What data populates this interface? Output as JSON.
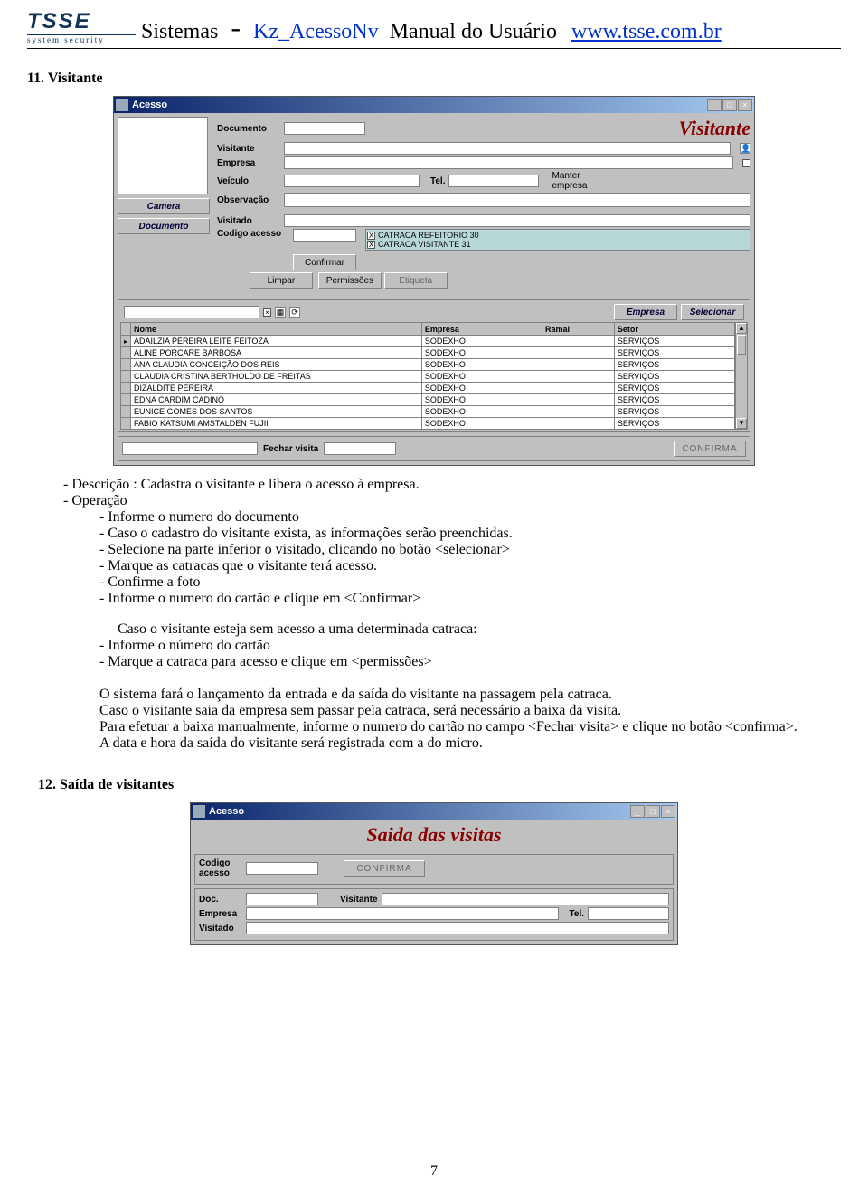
{
  "header": {
    "logo_text": "TSSE",
    "logo_sub": "system security",
    "t1": "Sistemas",
    "dash": "-",
    "t2": "Kz_AcessoNv",
    "t3": "Manual do Usuário",
    "link": "www.tsse.com.br"
  },
  "section1": {
    "title": "11. Visitante"
  },
  "win1": {
    "title": "Acesso",
    "min": "_",
    "max": "□",
    "close": "×",
    "labels": {
      "documento": "Documento",
      "visitante": "Visitante",
      "empresa": "Empresa",
      "veiculo": "Veículo",
      "observacao": "Observação",
      "tel": "Tel.",
      "manter_empresa": "Manter empresa",
      "visitado": "Visitado",
      "codigo_acesso": "Codigo acesso",
      "empresa2": "Empresa",
      "nome": "Nome",
      "ramal": "Ramal",
      "setor": "Setor",
      "fechar_visita": "Fechar visita"
    },
    "banner": "Visitante",
    "catracas": [
      "CATRACA REFEITORIO 30",
      "CATRACA VISITANTE 31"
    ],
    "buttons": {
      "confirmar": "Confirmar",
      "camera": "Camera",
      "documento_btn": "Documento",
      "limpar": "Limpar",
      "permissoes": "Permissões",
      "etiqueta": "Etiqueta",
      "selecionar": "Selecionar",
      "confirma_footer": "CONFIRMA"
    },
    "grid_rows": [
      {
        "nome": "ADAILZIA PEREIRA LEITE FEITOZA",
        "empresa": "SODEXHO",
        "ramal": "",
        "setor": "SERVIÇOS"
      },
      {
        "nome": "ALINE PORCARE BARBOSA",
        "empresa": "SODEXHO",
        "ramal": "",
        "setor": "SERVIÇOS"
      },
      {
        "nome": "ANA CLAUDIA CONCEIÇÃO DOS REIS",
        "empresa": "SODEXHO",
        "ramal": "",
        "setor": "SERVIÇOS"
      },
      {
        "nome": "CLAUDIA CRISTINA BERTHOLDO DE FREITAS",
        "empresa": "SODEXHO",
        "ramal": "",
        "setor": "SERVIÇOS"
      },
      {
        "nome": "DIZALDITE PEREIRA",
        "empresa": "SODEXHO",
        "ramal": "",
        "setor": "SERVIÇOS"
      },
      {
        "nome": "EDNA CARDIM CADINO",
        "empresa": "SODEXHO",
        "ramal": "",
        "setor": "SERVIÇOS"
      },
      {
        "nome": "EUNICE GOMES DOS SANTOS",
        "empresa": "SODEXHO",
        "ramal": "",
        "setor": "SERVIÇOS"
      },
      {
        "nome": "FABIO KATSUMI AMSTALDEN FUJII",
        "empresa": "SODEXHO",
        "ramal": "",
        "setor": "SERVIÇOS"
      }
    ]
  },
  "body": {
    "l1": "-    Descrição : Cadastra o visitante e libera o acesso à empresa.",
    "l2": "-    Operação",
    "l3": "-    Informe o numero do documento",
    "l4": "-    Caso o cadastro do visitante exista, as informações serão preenchidas.",
    "l5": "-    Selecione na parte inferior o visitado, clicando no botão <selecionar>",
    "l6": "-    Marque as catracas que o visitante terá acesso.",
    "l7": "-    Confirme a foto",
    "l8": "-    Informe o numero do cartão e clique em <Confirmar>",
    "p1": "Caso o visitante esteja sem acesso a uma determinada catraca:",
    "l9": "-    Informe o número do cartão",
    "l10": "-    Marque a catraca para acesso e clique em <permissões>",
    "p2": "O sistema fará o lançamento da entrada  e da saída do visitante na passagem pela catraca.",
    "p3": "Caso o visitante saia da empresa sem passar pela catraca, será necessário a baixa da visita.",
    "p4": "Para efetuar a baixa manualmente, informe o numero do cartão no campo <Fechar visita> e clique no botão <confirma>.",
    "p5": " A data e hora da saída do visitante será registrada com a do micro."
  },
  "section2": {
    "title": "12. Saída de visitantes"
  },
  "win2": {
    "title": "Acesso",
    "min": "_",
    "max": "□",
    "close": "×",
    "banner": "Saida das visitas",
    "labels": {
      "codigo_acesso": "Codigo acesso",
      "doc": "Doc.",
      "visitante": "Visitante",
      "empresa": "Empresa",
      "tel": "Tel.",
      "visitado": "Visitado"
    },
    "buttons": {
      "confirma": "CONFIRMA"
    }
  },
  "page_number": "7"
}
